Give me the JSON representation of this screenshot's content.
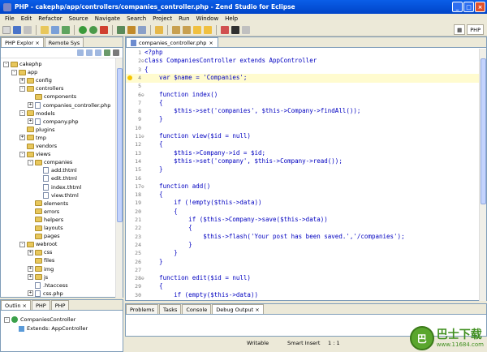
{
  "window": {
    "title": "PHP - cakephp/app/controllers/companies_controller.php - Zend Studio for Eclipse"
  },
  "menu": [
    "File",
    "Edit",
    "Refactor",
    "Source",
    "Navigate",
    "Search",
    "Project",
    "Run",
    "Window",
    "Help"
  ],
  "perspective": {
    "label": "PHP"
  },
  "explorer": {
    "tabs": [
      "PHP Explor",
      "Remote Sys"
    ],
    "tree": [
      {
        "label": "cakephp",
        "depth": 0,
        "kind": "project",
        "twisty": "-"
      },
      {
        "label": "app",
        "depth": 1,
        "kind": "folder",
        "twisty": "-"
      },
      {
        "label": "config",
        "depth": 2,
        "kind": "folder",
        "twisty": "+"
      },
      {
        "label": "controllers",
        "depth": 2,
        "kind": "folder",
        "twisty": "-"
      },
      {
        "label": "components",
        "depth": 3,
        "kind": "folder",
        "twisty": ""
      },
      {
        "label": "companies_controller.php",
        "depth": 3,
        "kind": "file",
        "twisty": "+"
      },
      {
        "label": "models",
        "depth": 2,
        "kind": "folder",
        "twisty": "-"
      },
      {
        "label": "company.php",
        "depth": 3,
        "kind": "file",
        "twisty": "+"
      },
      {
        "label": "plugins",
        "depth": 2,
        "kind": "folder",
        "twisty": ""
      },
      {
        "label": "tmp",
        "depth": 2,
        "kind": "folder",
        "twisty": "+"
      },
      {
        "label": "vendors",
        "depth": 2,
        "kind": "folder",
        "twisty": ""
      },
      {
        "label": "views",
        "depth": 2,
        "kind": "folder",
        "twisty": "-"
      },
      {
        "label": "companies",
        "depth": 3,
        "kind": "folder",
        "twisty": "-"
      },
      {
        "label": "add.thtml",
        "depth": 4,
        "kind": "file",
        "twisty": ""
      },
      {
        "label": "edit.thtml",
        "depth": 4,
        "kind": "file",
        "twisty": ""
      },
      {
        "label": "index.thtml",
        "depth": 4,
        "kind": "file",
        "twisty": ""
      },
      {
        "label": "view.thtml",
        "depth": 4,
        "kind": "file",
        "twisty": ""
      },
      {
        "label": "elements",
        "depth": 3,
        "kind": "folder",
        "twisty": ""
      },
      {
        "label": "errors",
        "depth": 3,
        "kind": "folder",
        "twisty": ""
      },
      {
        "label": "helpers",
        "depth": 3,
        "kind": "folder",
        "twisty": ""
      },
      {
        "label": "layouts",
        "depth": 3,
        "kind": "folder",
        "twisty": ""
      },
      {
        "label": "pages",
        "depth": 3,
        "kind": "folder",
        "twisty": ""
      },
      {
        "label": "webroot",
        "depth": 2,
        "kind": "folder",
        "twisty": "-"
      },
      {
        "label": "css",
        "depth": 3,
        "kind": "folder",
        "twisty": "+"
      },
      {
        "label": "files",
        "depth": 3,
        "kind": "folder",
        "twisty": ""
      },
      {
        "label": "img",
        "depth": 3,
        "kind": "folder",
        "twisty": "+"
      },
      {
        "label": "js",
        "depth": 3,
        "kind": "folder",
        "twisty": "+"
      },
      {
        "label": ".htaccess",
        "depth": 3,
        "kind": "file",
        "twisty": ""
      },
      {
        "label": "css.php",
        "depth": 3,
        "kind": "file",
        "twisty": "+"
      }
    ]
  },
  "editor": {
    "tab": "companies_controller.php",
    "lines": [
      {
        "n": "1",
        "text": "<?php",
        "fold": ""
      },
      {
        "n": "2",
        "text": "class CompaniesController extends AppController",
        "fold": "⊖"
      },
      {
        "n": "3",
        "text": "{",
        "fold": ""
      },
      {
        "n": "4",
        "text": "    var $name = 'Companies';",
        "fold": "",
        "highlight": true
      },
      {
        "n": "5",
        "text": "",
        "fold": ""
      },
      {
        "n": "6",
        "text": "    function index()",
        "fold": "⊖"
      },
      {
        "n": "7",
        "text": "    {",
        "fold": ""
      },
      {
        "n": "8",
        "text": "        $this->set('companies', $this->Company->findAll());",
        "fold": ""
      },
      {
        "n": "9",
        "text": "    }",
        "fold": ""
      },
      {
        "n": "10",
        "text": "",
        "fold": ""
      },
      {
        "n": "11",
        "text": "    function view($id = null)",
        "fold": "⊖"
      },
      {
        "n": "12",
        "text": "    {",
        "fold": ""
      },
      {
        "n": "13",
        "text": "        $this->Company->id = $id;",
        "fold": ""
      },
      {
        "n": "14",
        "text": "        $this->set('company', $this->Company->read());",
        "fold": ""
      },
      {
        "n": "15",
        "text": "    }",
        "fold": ""
      },
      {
        "n": "16",
        "text": "",
        "fold": ""
      },
      {
        "n": "17",
        "text": "    function add()",
        "fold": "⊖"
      },
      {
        "n": "18",
        "text": "    {",
        "fold": ""
      },
      {
        "n": "19",
        "text": "        if (!empty($this->data))",
        "fold": ""
      },
      {
        "n": "20",
        "text": "        {",
        "fold": ""
      },
      {
        "n": "21",
        "text": "            if ($this->Company->save($this->data))",
        "fold": ""
      },
      {
        "n": "22",
        "text": "            {",
        "fold": ""
      },
      {
        "n": "23",
        "text": "                $this->flash('Your post has been saved.','/companies');",
        "fold": ""
      },
      {
        "n": "24",
        "text": "            }",
        "fold": ""
      },
      {
        "n": "25",
        "text": "        }",
        "fold": ""
      },
      {
        "n": "26",
        "text": "    }",
        "fold": ""
      },
      {
        "n": "27",
        "text": "",
        "fold": ""
      },
      {
        "n": "28",
        "text": "    function edit($id = null)",
        "fold": "⊖"
      },
      {
        "n": "29",
        "text": "    {",
        "fold": ""
      },
      {
        "n": "30",
        "text": "        if (empty($this->data))",
        "fold": ""
      }
    ]
  },
  "outline": {
    "tabs": [
      "Outlin",
      "PHP",
      "PHP"
    ],
    "items": [
      "CompaniesController",
      "Extends: AppController"
    ]
  },
  "bottom_tabs": [
    "Problems",
    "Tasks",
    "Console",
    "Debug Output"
  ],
  "status": {
    "writable": "Writable",
    "insert": "Smart Insert",
    "position": "1 : 1"
  },
  "watermark": {
    "text": "巴士下载",
    "url": "www.11684.com"
  }
}
